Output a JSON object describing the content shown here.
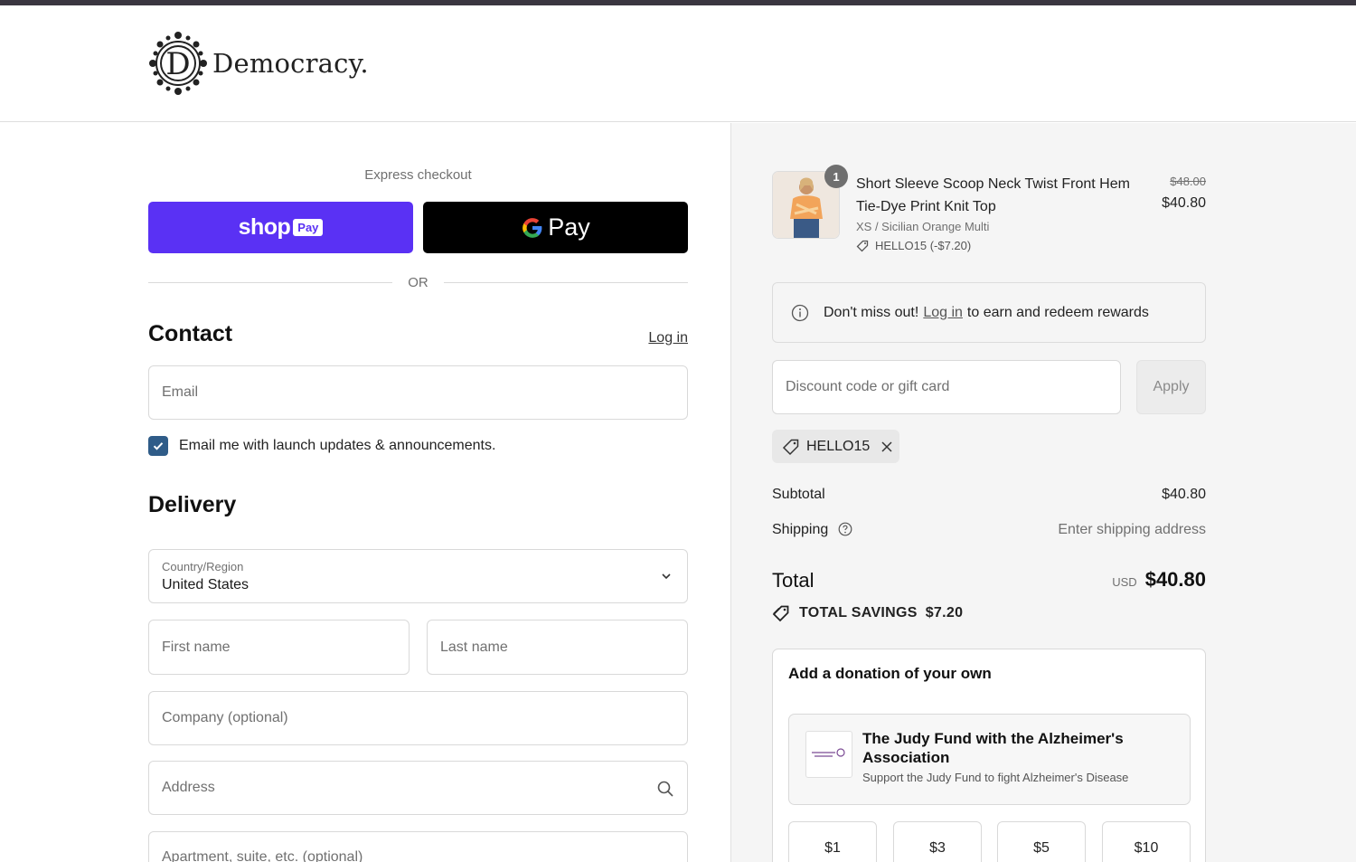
{
  "brand": {
    "name": "Democracy."
  },
  "express": {
    "label": "Express checkout",
    "shoppay": {
      "shop": "shop",
      "pay": "Pay"
    },
    "gpay": {
      "pay": "Pay"
    },
    "or": "OR"
  },
  "contact": {
    "heading": "Contact",
    "login": "Log in",
    "email_placeholder": "Email",
    "newsletter_label": "Email me with launch updates & announcements.",
    "newsletter_checked": true
  },
  "delivery": {
    "heading": "Delivery",
    "country_label": "Country/Region",
    "country_value": "United States",
    "first_name_placeholder": "First name",
    "last_name_placeholder": "Last name",
    "company_placeholder": "Company (optional)",
    "address_placeholder": "Address",
    "apartment_placeholder": "Apartment, suite, etc. (optional)"
  },
  "cart": {
    "item": {
      "quantity": "1",
      "title": "Short Sleeve Scoop Neck Twist Front Hem Tie-Dye Print Knit Top",
      "variant": "XS / Sicilian Orange Multi",
      "discount": "HELLO15 (-$7.20)",
      "original_price": "$48.00",
      "price": "$40.80"
    },
    "rewards": {
      "prefix": "Don't miss out!",
      "link": "Log in",
      "suffix": "to earn and redeem rewards"
    },
    "discount_placeholder": "Discount code or gift card",
    "apply_label": "Apply",
    "applied_code": "HELLO15",
    "subtotal_label": "Subtotal",
    "subtotal_value": "$40.80",
    "shipping_label": "Shipping",
    "shipping_value": "Enter shipping address",
    "total_label": "Total",
    "total_currency": "USD",
    "total_value": "$40.80",
    "savings_label": "TOTAL SAVINGS",
    "savings_value": "$7.20"
  },
  "donation": {
    "title": "Add a donation of your own",
    "charity_name": "The Judy Fund with the Alzheimer's Association",
    "charity_desc": "Support the Judy Fund to fight Alzheimer's Disease",
    "amounts": [
      "$1",
      "$3",
      "$5",
      "$10"
    ]
  },
  "colors": {
    "shoppay": "#5a31f4",
    "gpay": "#000000",
    "checkbox": "#2f5c88",
    "summary_bg": "#f5f5f5"
  }
}
